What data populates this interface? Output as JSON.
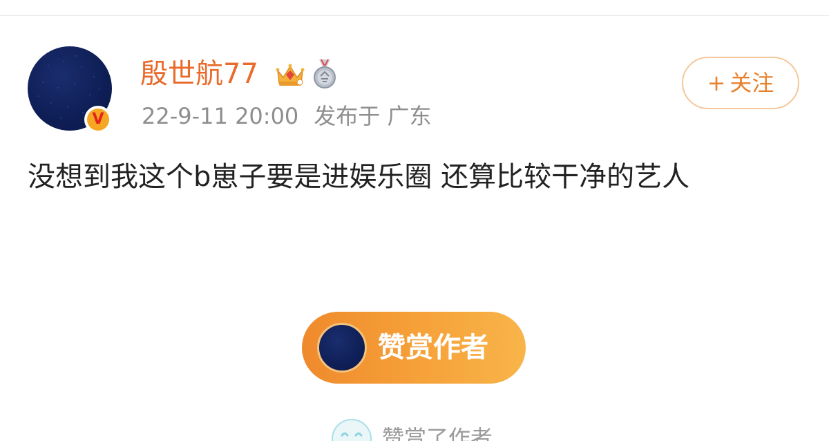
{
  "post": {
    "author": {
      "name": "殷世航77",
      "verified_mark": "V"
    },
    "timestamp": "22-9-11 20:00",
    "source": "发布于 广东",
    "follow_button": {
      "plus": "+",
      "label": "关注"
    },
    "content": "没想到我这个b崽子要是进娱乐圈 还算比较干净的艺人"
  },
  "reward": {
    "button_label": "赞赏作者",
    "rewarded_text": "赞赏了作者"
  },
  "icons": {
    "crown": "crown-icon",
    "medal": "medal-icon",
    "verified": "verified-badge-icon",
    "rewarded": "smile-face-icon"
  },
  "colors": {
    "username": "#e86b2c",
    "follow_border": "#f5c79a",
    "follow_text": "#e8812c",
    "reward_gradient_start": "#ef8a2c",
    "reward_gradient_end": "#f8b54a",
    "meta_text": "#8e8e8e",
    "body_text": "#222222"
  }
}
